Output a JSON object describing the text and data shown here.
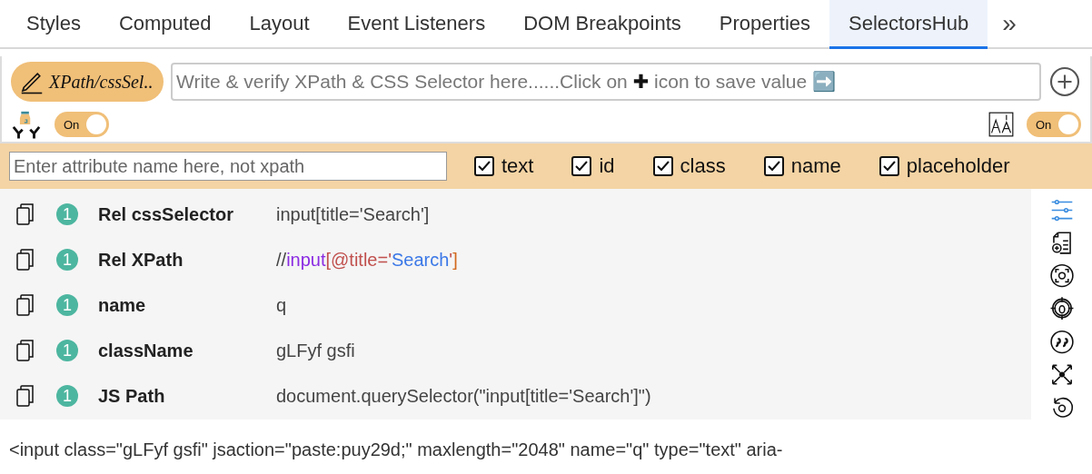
{
  "tabs": [
    {
      "label": "Styles",
      "selected": false
    },
    {
      "label": "Computed",
      "selected": false
    },
    {
      "label": "Layout",
      "selected": false
    },
    {
      "label": "Event Listeners",
      "selected": false
    },
    {
      "label": "DOM Breakpoints",
      "selected": false
    },
    {
      "label": "Properties",
      "selected": false
    },
    {
      "label": "SelectorsHub",
      "selected": true
    }
  ],
  "more_tabs": "»",
  "selector_button": "XPath/cssSel..",
  "selector_input": {
    "placeholder_before": "Write & verify XPath & CSS Selector here......Click on ",
    "placeholder_plus": "✚",
    "placeholder_after": " icon to save value ➡️"
  },
  "left_toggle": {
    "label": "On",
    "on": true
  },
  "right_toggle": {
    "label": "On",
    "on": true
  },
  "attribute_input": {
    "placeholder": "Enter attribute name here, not xpath"
  },
  "attributes": [
    {
      "label": "text",
      "checked": true
    },
    {
      "label": "id",
      "checked": true
    },
    {
      "label": "class",
      "checked": true
    },
    {
      "label": "name",
      "checked": true
    },
    {
      "label": "placeholder",
      "checked": true
    }
  ],
  "results": [
    {
      "count": "1",
      "label": "Rel cssSelector",
      "value": [
        {
          "kind": "plain",
          "text": "input[title='Search']"
        }
      ]
    },
    {
      "count": "1",
      "label": "Rel XPath",
      "value": [
        {
          "kind": "plain",
          "text": "//"
        },
        {
          "kind": "tag",
          "text": "input"
        },
        {
          "kind": "attr",
          "text": "[@title='"
        },
        {
          "kind": "string",
          "text": "Search"
        },
        {
          "kind": "attr",
          "text": "'"
        },
        {
          "kind": "bracket",
          "text": "]"
        }
      ]
    },
    {
      "count": "1",
      "label": "name",
      "value": [
        {
          "kind": "plain",
          "text": "q"
        }
      ]
    },
    {
      "count": "1",
      "label": "className",
      "value": [
        {
          "kind": "plain",
          "text": "gLFyf gsfi"
        }
      ]
    },
    {
      "count": "1",
      "label": "JS Path",
      "value": [
        {
          "kind": "plain",
          "text": "document.querySelector(\"input[title='Search']\")"
        }
      ]
    }
  ],
  "element_html": "<input class=\"gLFyf gsfi\" jsaction=\"paste:puy29d;\" maxlength=\"2048\" name=\"q\" type=\"text\" aria-"
}
